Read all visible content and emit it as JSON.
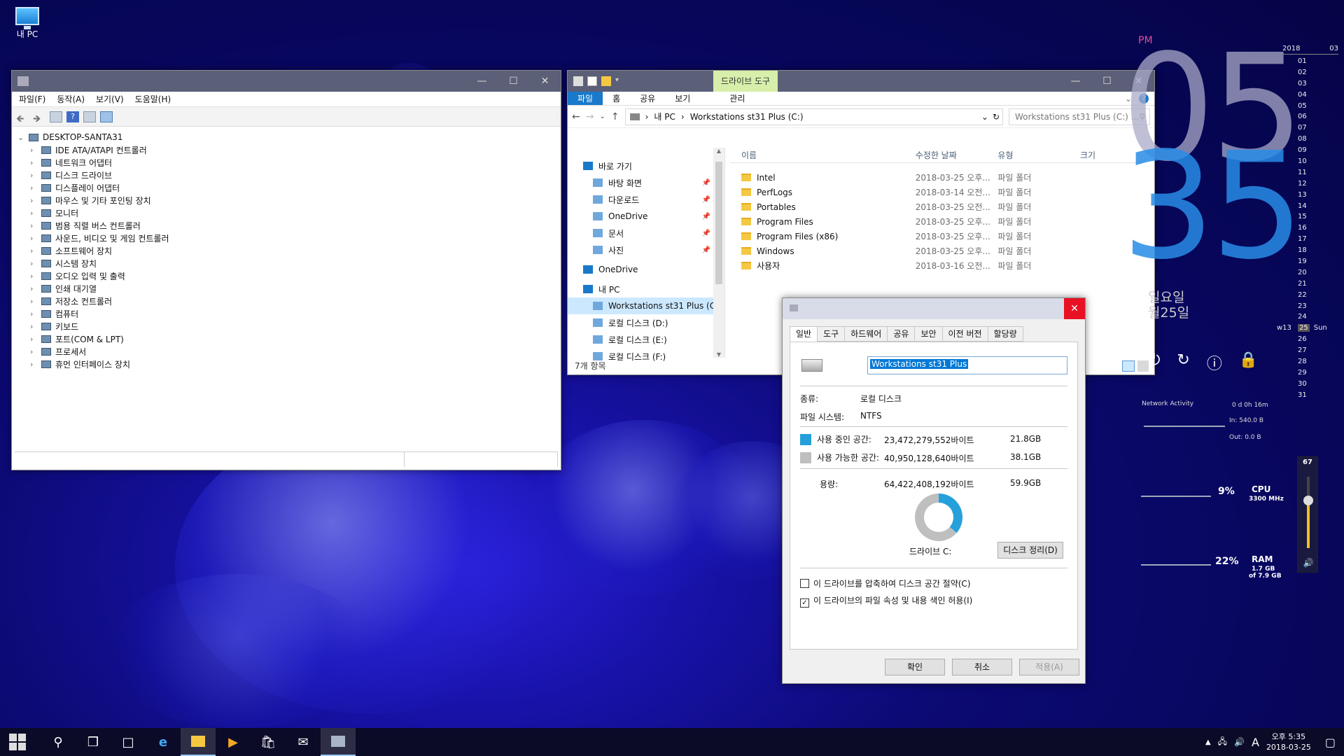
{
  "desktop": {
    "icon_label": "내 PC"
  },
  "device_manager": {
    "menu": [
      "파일(F)",
      "동작(A)",
      "보기(V)",
      "도움말(H)"
    ],
    "root": "DESKTOP-SANTA31",
    "items": [
      "IDE ATA/ATAPI 컨트롤러",
      "네트워크 어댑터",
      "디스크 드라이브",
      "디스플레이 어댑터",
      "마우스 및 기타 포인팅 장치",
      "모니터",
      "범용 직렬 버스 컨트롤러",
      "사운드, 비디오 및 게임 컨트롤러",
      "소프트웨어 장치",
      "시스템 장치",
      "오디오 입력 및 출력",
      "인쇄 대기열",
      "저장소 컨트롤러",
      "컴퓨터",
      "키보드",
      "포트(COM & LPT)",
      "프로세서",
      "휴먼 인터페이스 장치"
    ]
  },
  "explorer": {
    "contextual_tab": "드라이브 도구",
    "ribbon_tabs": [
      "파일",
      "홈",
      "공유",
      "보기",
      "관리"
    ],
    "breadcrumb": [
      "내 PC",
      "Workstations st31 Plus (C:)"
    ],
    "search_placeholder": "Workstations st31 Plus (C:) ...",
    "columns": [
      "이름",
      "수정한 날짜",
      "유형",
      "크기"
    ],
    "nav": [
      {
        "label": "바로 가기",
        "level": 0
      },
      {
        "label": "바탕 화면",
        "level": 1,
        "pinned": true
      },
      {
        "label": "다운로드",
        "level": 1,
        "pinned": true
      },
      {
        "label": "OneDrive",
        "level": 1,
        "pinned": true
      },
      {
        "label": "문서",
        "level": 1,
        "pinned": true
      },
      {
        "label": "사진",
        "level": 1,
        "pinned": true
      },
      {
        "label": "OneDrive",
        "level": 0
      },
      {
        "label": "내 PC",
        "level": 0
      },
      {
        "label": "Workstations st31 Plus (C:)",
        "level": 1,
        "selected": true
      },
      {
        "label": "로컬 디스크 (D:)",
        "level": 1
      },
      {
        "label": "로컬 디스크 (E:)",
        "level": 1
      },
      {
        "label": "로컬 디스크 (F:)",
        "level": 1
      }
    ],
    "files": [
      {
        "name": "Intel",
        "date": "2018-03-25 오후...",
        "type": "파일 폴더"
      },
      {
        "name": "PerfLogs",
        "date": "2018-03-14 오전...",
        "type": "파일 폴더"
      },
      {
        "name": "Portables",
        "date": "2018-03-25 오전...",
        "type": "파일 폴더"
      },
      {
        "name": "Program Files",
        "date": "2018-03-25 오후...",
        "type": "파일 폴더"
      },
      {
        "name": "Program Files (x86)",
        "date": "2018-03-25 오후...",
        "type": "파일 폴더"
      },
      {
        "name": "Windows",
        "date": "2018-03-25 오후...",
        "type": "파일 폴더"
      },
      {
        "name": "사용자",
        "date": "2018-03-16 오전...",
        "type": "파일 폴더"
      }
    ],
    "status": "7개 항목"
  },
  "properties": {
    "tabs": [
      "일반",
      "도구",
      "하드웨어",
      "공유",
      "보안",
      "이전 버전",
      "할당량"
    ],
    "drive_name": "Workstations st31 Plus",
    "type_label": "종류:",
    "type_value": "로컬 디스크",
    "fs_label": "파일 시스템:",
    "fs_value": "NTFS",
    "used_label": "사용 중인 공간:",
    "used_bytes": "23,472,279,552바이트",
    "used_gb": "21.8GB",
    "free_label": "사용 가능한 공간:",
    "free_bytes": "40,950,128,640바이트",
    "free_gb": "38.1GB",
    "cap_label": "용량:",
    "cap_bytes": "64,422,408,192바이트",
    "cap_gb": "59.9GB",
    "used_fraction": 0.364,
    "drive_label": "드라이브 C:",
    "cleanup_btn": "디스크 정리(D)",
    "compress_label": "이 드라이브를 압축하여 디스크 공간 절약(C)",
    "compress_checked": false,
    "index_label": "이 드라이브의 파일 속성 및 내용 색인 허용(I)",
    "index_checked": true,
    "ok": "확인",
    "cancel": "취소",
    "apply": "적용(A)",
    "used_color": "#26a0da",
    "free_color": "#bfbfbf"
  },
  "clock": {
    "ampm": "PM",
    "hour": "05",
    "minute": "35",
    "weekday": "일요일",
    "date": "월25일"
  },
  "calendar": {
    "year": "2018",
    "month": "03",
    "days": [
      "01",
      "02",
      "03",
      "04",
      "05",
      "06",
      "07",
      "08",
      "09",
      "10",
      "11",
      "12",
      "13",
      "14",
      "15",
      "16",
      "17",
      "18",
      "19",
      "20",
      "21",
      "22",
      "23",
      "24",
      "25",
      "26",
      "27",
      "28",
      "29",
      "30",
      "31"
    ],
    "today": "25",
    "week": "w13",
    "today_day": "Sun"
  },
  "widgets": {
    "network_title": "Network Activity",
    "uptime": "0 d 0h 16m",
    "net_in": "In: 540.0 B",
    "net_out": "Out: 0.0 B",
    "cpu_pct": "9%",
    "cpu_label": "CPU",
    "cpu_freq": "3300 MHz",
    "ram_pct": "22%",
    "ram_label": "RAM",
    "ram_used": "1.7 GB",
    "ram_total": "of 7.9 GB",
    "volume": "67",
    "volume_level": 0.67
  },
  "taskbar": {
    "time": "오후 5:35",
    "date": "2018-03-25",
    "ime": "A"
  }
}
